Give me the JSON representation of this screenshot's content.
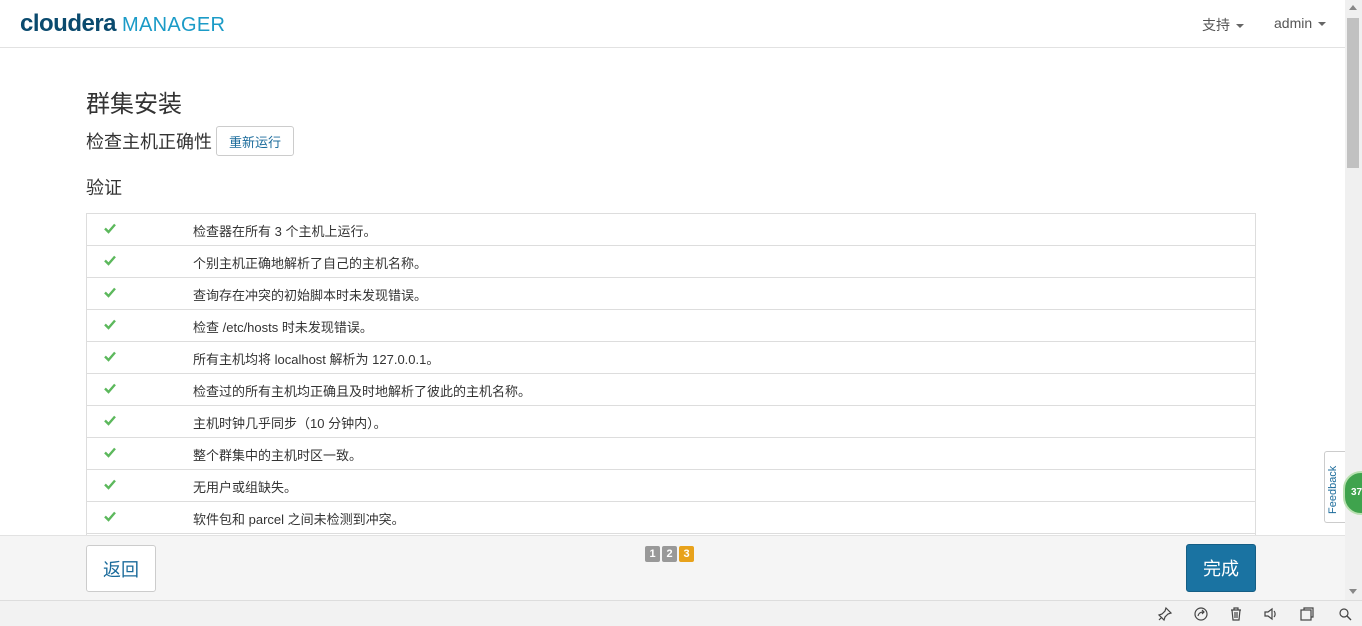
{
  "header": {
    "brand": "cloudera",
    "product": "MANAGER",
    "support_label": "支持",
    "user_label": "admin"
  },
  "main": {
    "title": "群集安装",
    "subtitle": "检查主机正确性",
    "rerun_label": "重新运行",
    "section_title": "验证",
    "checks": [
      "检查器在所有 3 个主机上运行。",
      "个别主机正确地解析了自己的主机名称。",
      "查询存在冲突的初始脚本时未发现错误。",
      "检查 /etc/hosts 时未发现错误。",
      "所有主机均将 localhost 解析为 127.0.0.1。",
      "检查过的所有主机均正确且及时地解析了彼此的主机名称。",
      "主机时钟几乎同步（10 分钟内）。",
      "整个群集中的主机时区一致。",
      "无用户或组缺失。",
      "软件包和 parcel 之间未检测到冲突。"
    ]
  },
  "footer": {
    "back_label": "返回",
    "finish_label": "完成",
    "steps": [
      "1",
      "2",
      "3"
    ],
    "active_step": 3
  },
  "feedback": {
    "label": "Feedback",
    "badge": "37"
  },
  "colors": {
    "check_green": "#5cb85c",
    "primary": "#1a73a2",
    "step_active": "#e8a21b",
    "step_inactive": "#999999"
  },
  "browser_bar_icons": [
    "pin-icon",
    "share-icon",
    "trash-icon",
    "speaker-icon",
    "window-icon",
    "search-icon"
  ]
}
